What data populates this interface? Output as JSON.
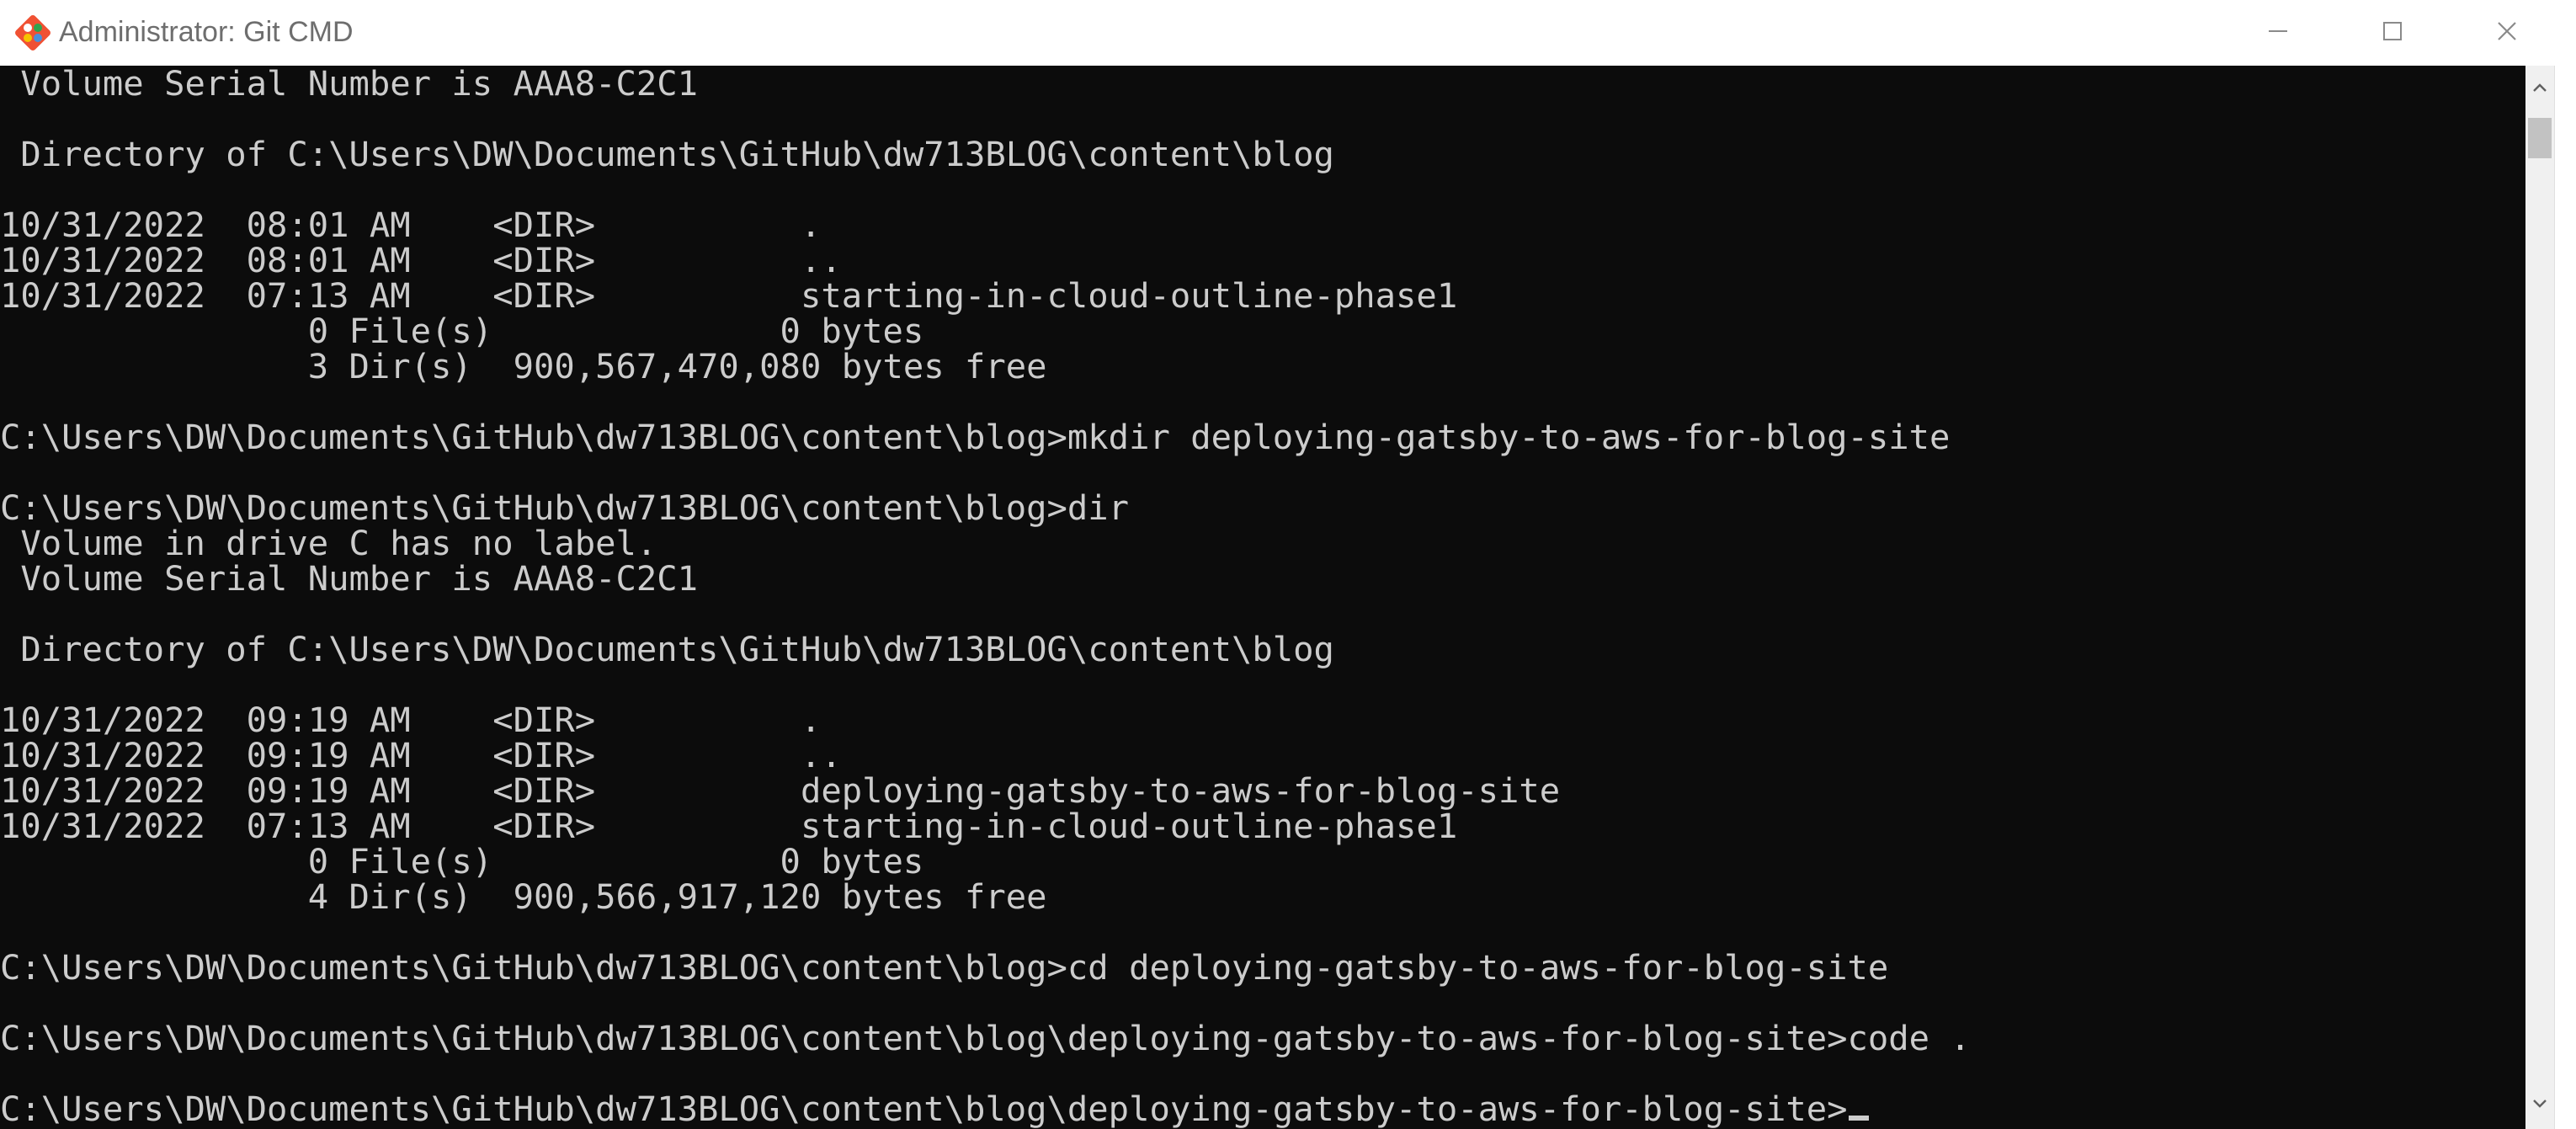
{
  "window": {
    "title": "Administrator: Git CMD",
    "icon": "git-icon"
  },
  "controls": {
    "minimize_icon": "minimize-icon",
    "maximize_icon": "maximize-icon",
    "close_icon": "close-icon"
  },
  "console": {
    "lines": [
      " Volume Serial Number is AAA8-C2C1",
      "",
      " Directory of C:\\Users\\DW\\Documents\\GitHub\\dw713BLOG\\content\\blog",
      "",
      "10/31/2022  08:01 AM    <DIR>          .",
      "10/31/2022  08:01 AM    <DIR>          ..",
      "10/31/2022  07:13 AM    <DIR>          starting-in-cloud-outline-phase1",
      "               0 File(s)              0 bytes",
      "               3 Dir(s)  900,567,470,080 bytes free",
      "",
      "C:\\Users\\DW\\Documents\\GitHub\\dw713BLOG\\content\\blog>mkdir deploying-gatsby-to-aws-for-blog-site",
      "",
      "C:\\Users\\DW\\Documents\\GitHub\\dw713BLOG\\content\\blog>dir",
      " Volume in drive C has no label.",
      " Volume Serial Number is AAA8-C2C1",
      "",
      " Directory of C:\\Users\\DW\\Documents\\GitHub\\dw713BLOG\\content\\blog",
      "",
      "10/31/2022  09:19 AM    <DIR>          .",
      "10/31/2022  09:19 AM    <DIR>          ..",
      "10/31/2022  09:19 AM    <DIR>          deploying-gatsby-to-aws-for-blog-site",
      "10/31/2022  07:13 AM    <DIR>          starting-in-cloud-outline-phase1",
      "               0 File(s)              0 bytes",
      "               4 Dir(s)  900,566,917,120 bytes free",
      "",
      "C:\\Users\\DW\\Documents\\GitHub\\dw713BLOG\\content\\blog>cd deploying-gatsby-to-aws-for-blog-site",
      "",
      "C:\\Users\\DW\\Documents\\GitHub\\dw713BLOG\\content\\blog\\deploying-gatsby-to-aws-for-blog-site>code .",
      "",
      "C:\\Users\\DW\\Documents\\GitHub\\dw713BLOG\\content\\blog\\deploying-gatsby-to-aws-for-blog-site>"
    ]
  },
  "colors": {
    "console_bg": "#0c0c0c",
    "console_fg": "#cccccc",
    "titlebar_bg": "#ffffff",
    "title_fg": "#6e6e6e"
  }
}
